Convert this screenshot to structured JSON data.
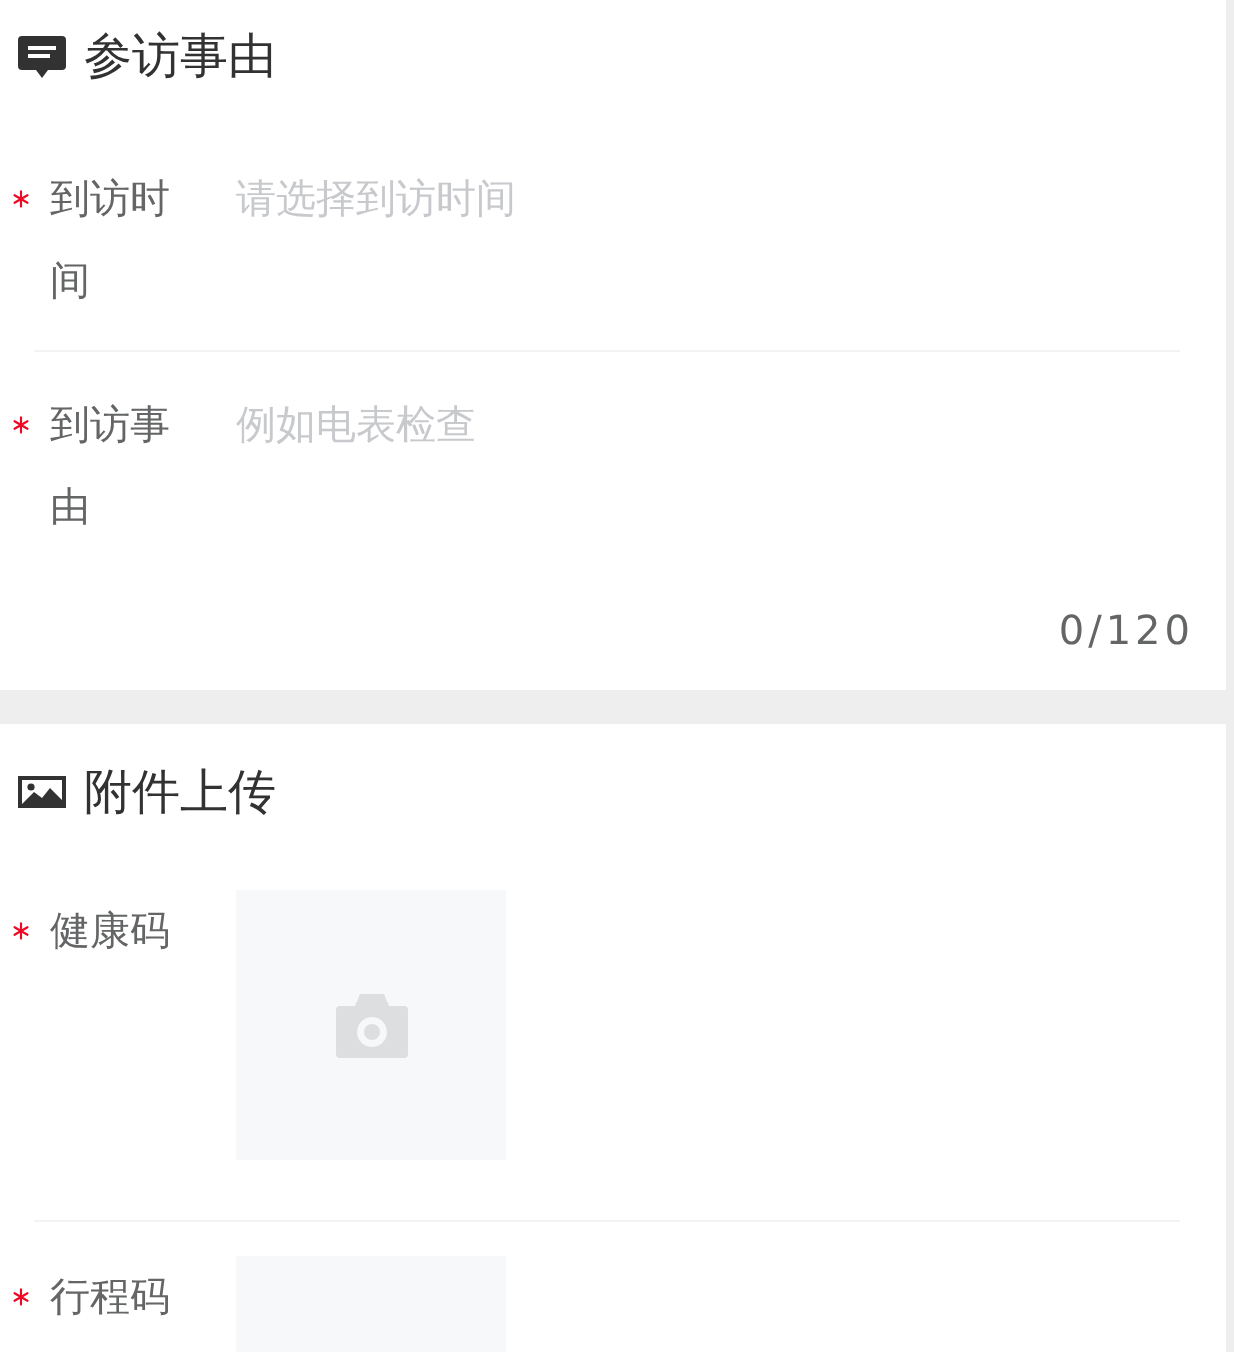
{
  "sections": [
    {
      "kind": "fields",
      "title": "参访事由",
      "fields": [
        {
          "kind": "picker",
          "label": "到访时间",
          "required": true,
          "placeholder": "请选择到访时间"
        },
        {
          "kind": "textarea",
          "label": "到访事由",
          "required": true,
          "placeholder": "例如电表检查",
          "counter": "0/120"
        }
      ]
    },
    {
      "kind": "uploads",
      "title": "附件上传",
      "fields": [
        {
          "kind": "upload",
          "label": "健康码",
          "required": true
        },
        {
          "kind": "upload",
          "label": "行程码",
          "required": true
        }
      ]
    }
  ]
}
